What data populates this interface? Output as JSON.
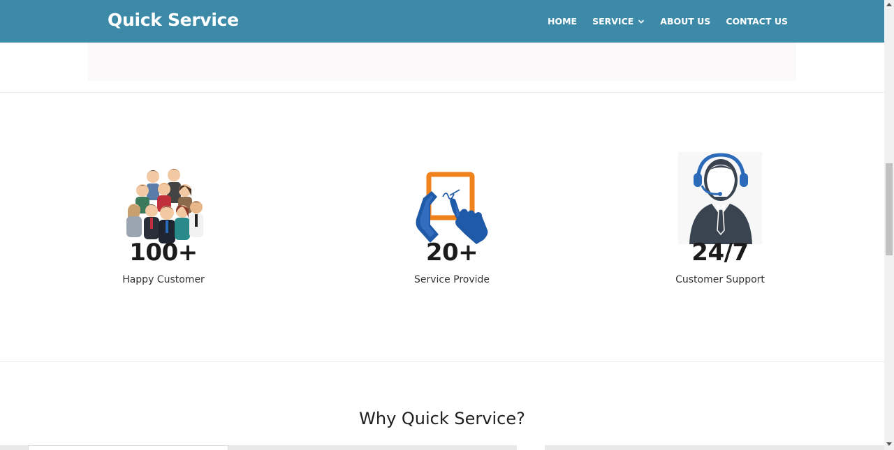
{
  "header": {
    "brand": "Quick Service",
    "nav": [
      {
        "label": "HOME"
      },
      {
        "label": "SERVICE",
        "has_dropdown": true
      },
      {
        "label": "ABOUT US"
      },
      {
        "label": "CONTACT US"
      }
    ]
  },
  "stats": [
    {
      "value": "100+",
      "label": "Happy Customer",
      "icon": "happy-customers-icon"
    },
    {
      "value": "20+",
      "label": "Service Provide",
      "icon": "touch-tablet-icon"
    },
    {
      "value": "24/7",
      "label": "Customer Support",
      "icon": "headset-support-icon"
    }
  ],
  "section": {
    "title": "Why Quick Service?"
  },
  "colors": {
    "navbar": "#3d8aa8",
    "accent_underline": "#e3141b",
    "icon_blue": "#1f5aa8",
    "icon_orange": "#f0821e",
    "support_dark": "#3a4450"
  }
}
